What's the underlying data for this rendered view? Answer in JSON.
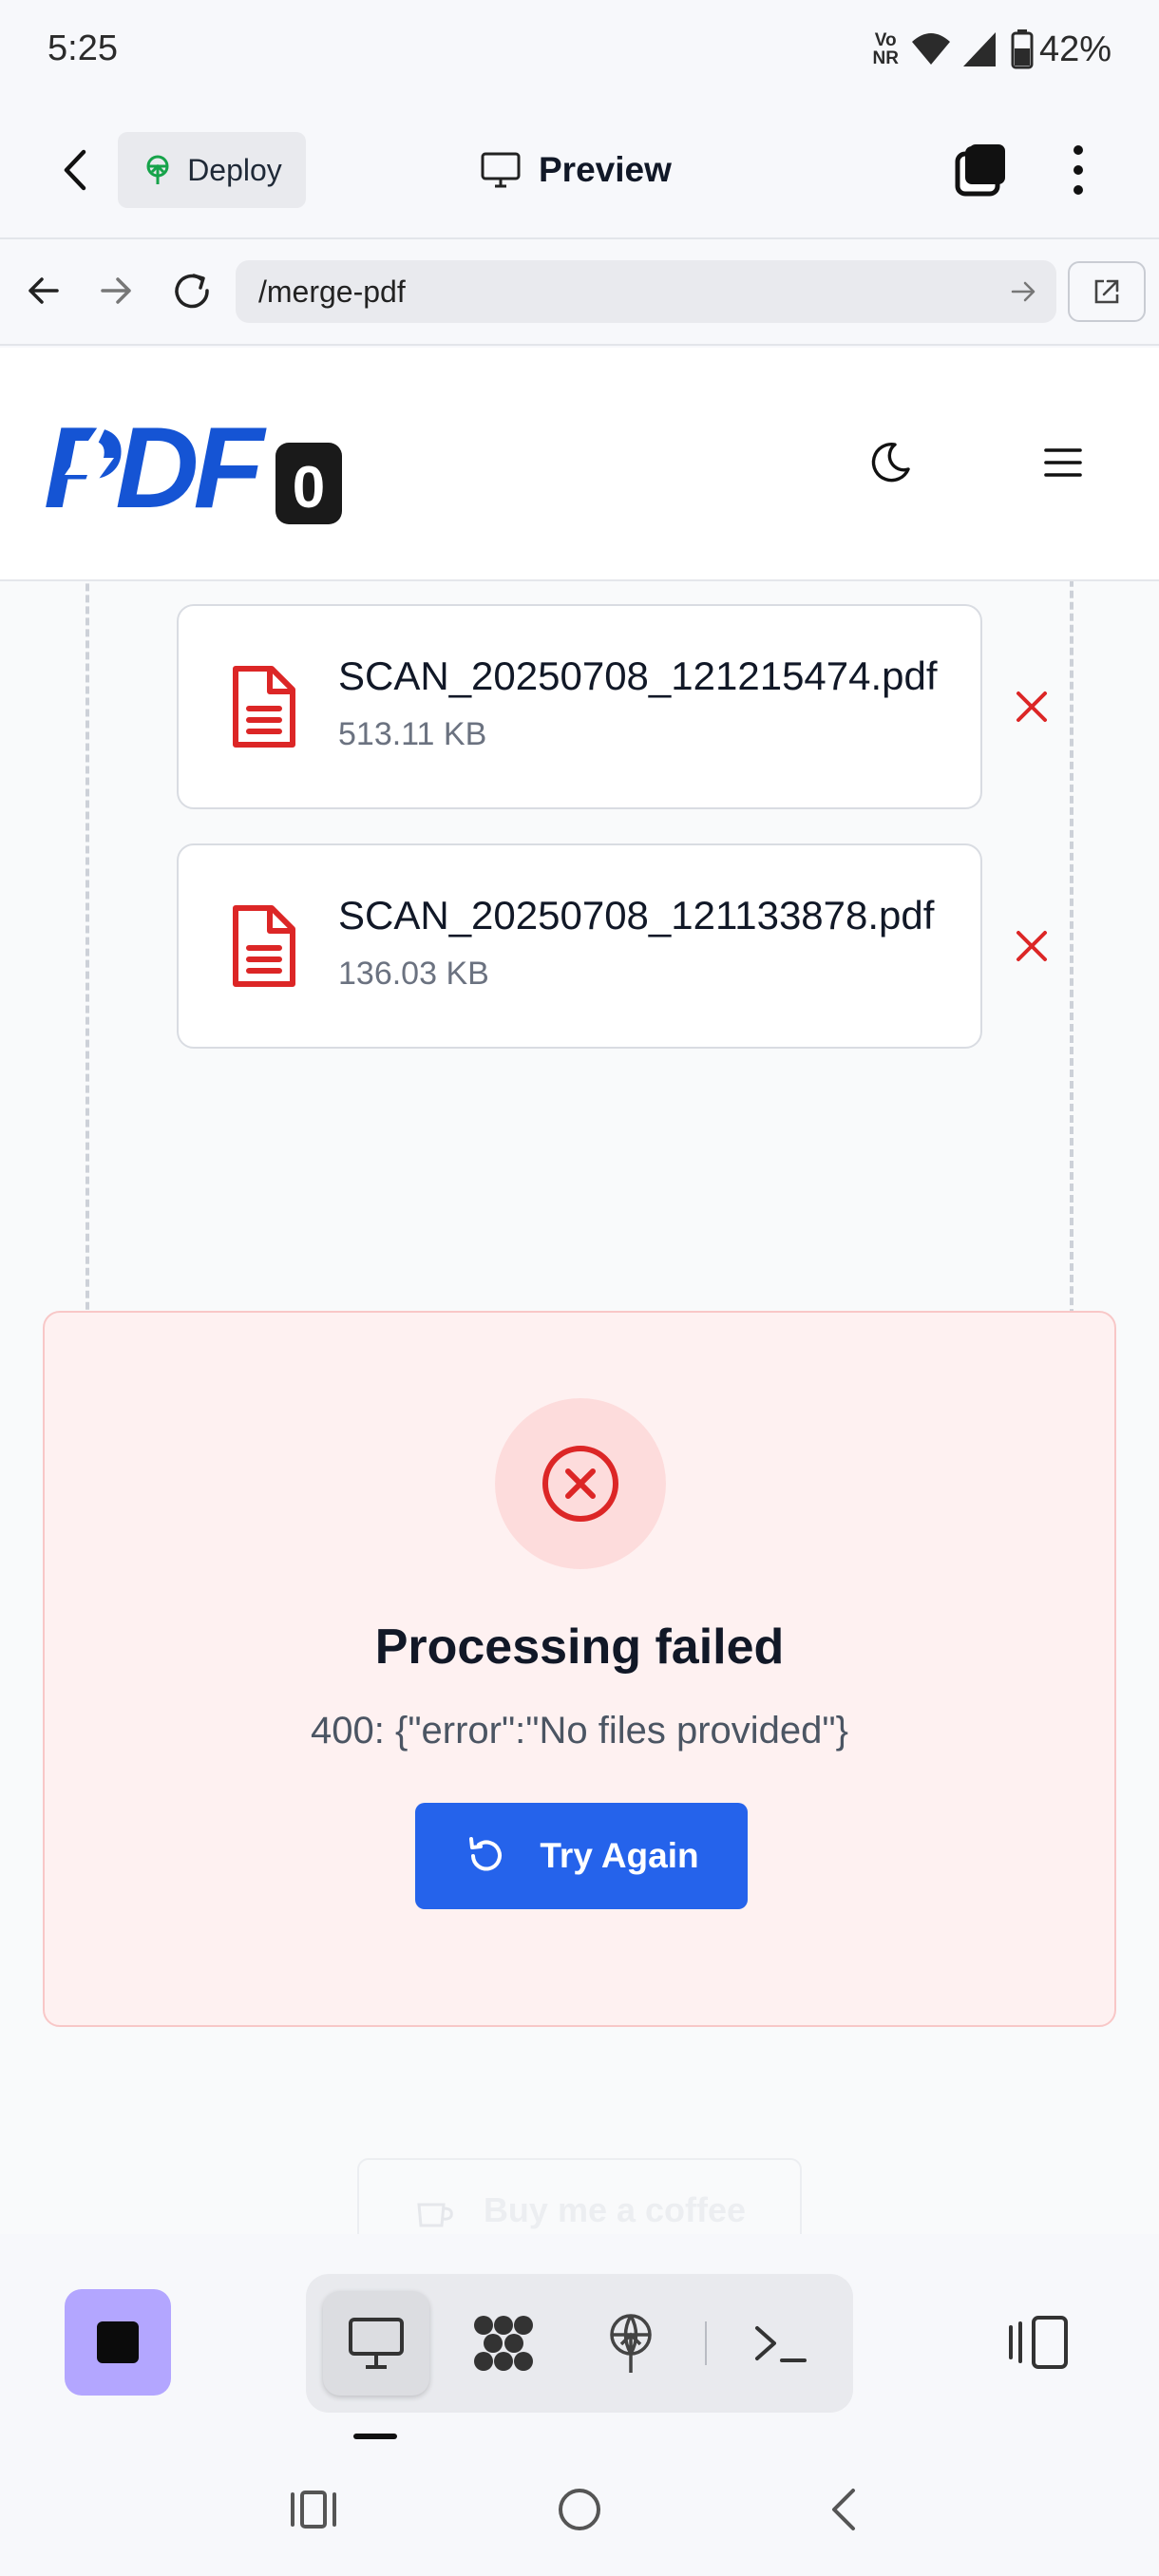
{
  "status_bar": {
    "time": "5:25",
    "volte_top": "Vo",
    "volte_bottom": "NR",
    "battery": "42%"
  },
  "app_header": {
    "deploy_label": "Deploy",
    "preview_label": "Preview"
  },
  "url_bar": {
    "url": "/merge-pdf"
  },
  "site": {
    "logo_text": "PDF",
    "logo_badge": "0"
  },
  "files": [
    {
      "name": "SCAN_20250708_121215474.pdf",
      "size": "513.11 KB"
    },
    {
      "name": "SCAN_20250708_121133878.pdf",
      "size": "136.03 KB"
    }
  ],
  "error": {
    "title": "Processing failed",
    "message": "400: {\"error\":\"No files provided\"}",
    "retry_label": "Try Again"
  },
  "coffee_label": "Buy me a coffee",
  "colors": {
    "primary": "#2563eb",
    "error": "#dc2626",
    "stop_button": "#b3a6ff",
    "logo_blue": "#1554d4"
  }
}
